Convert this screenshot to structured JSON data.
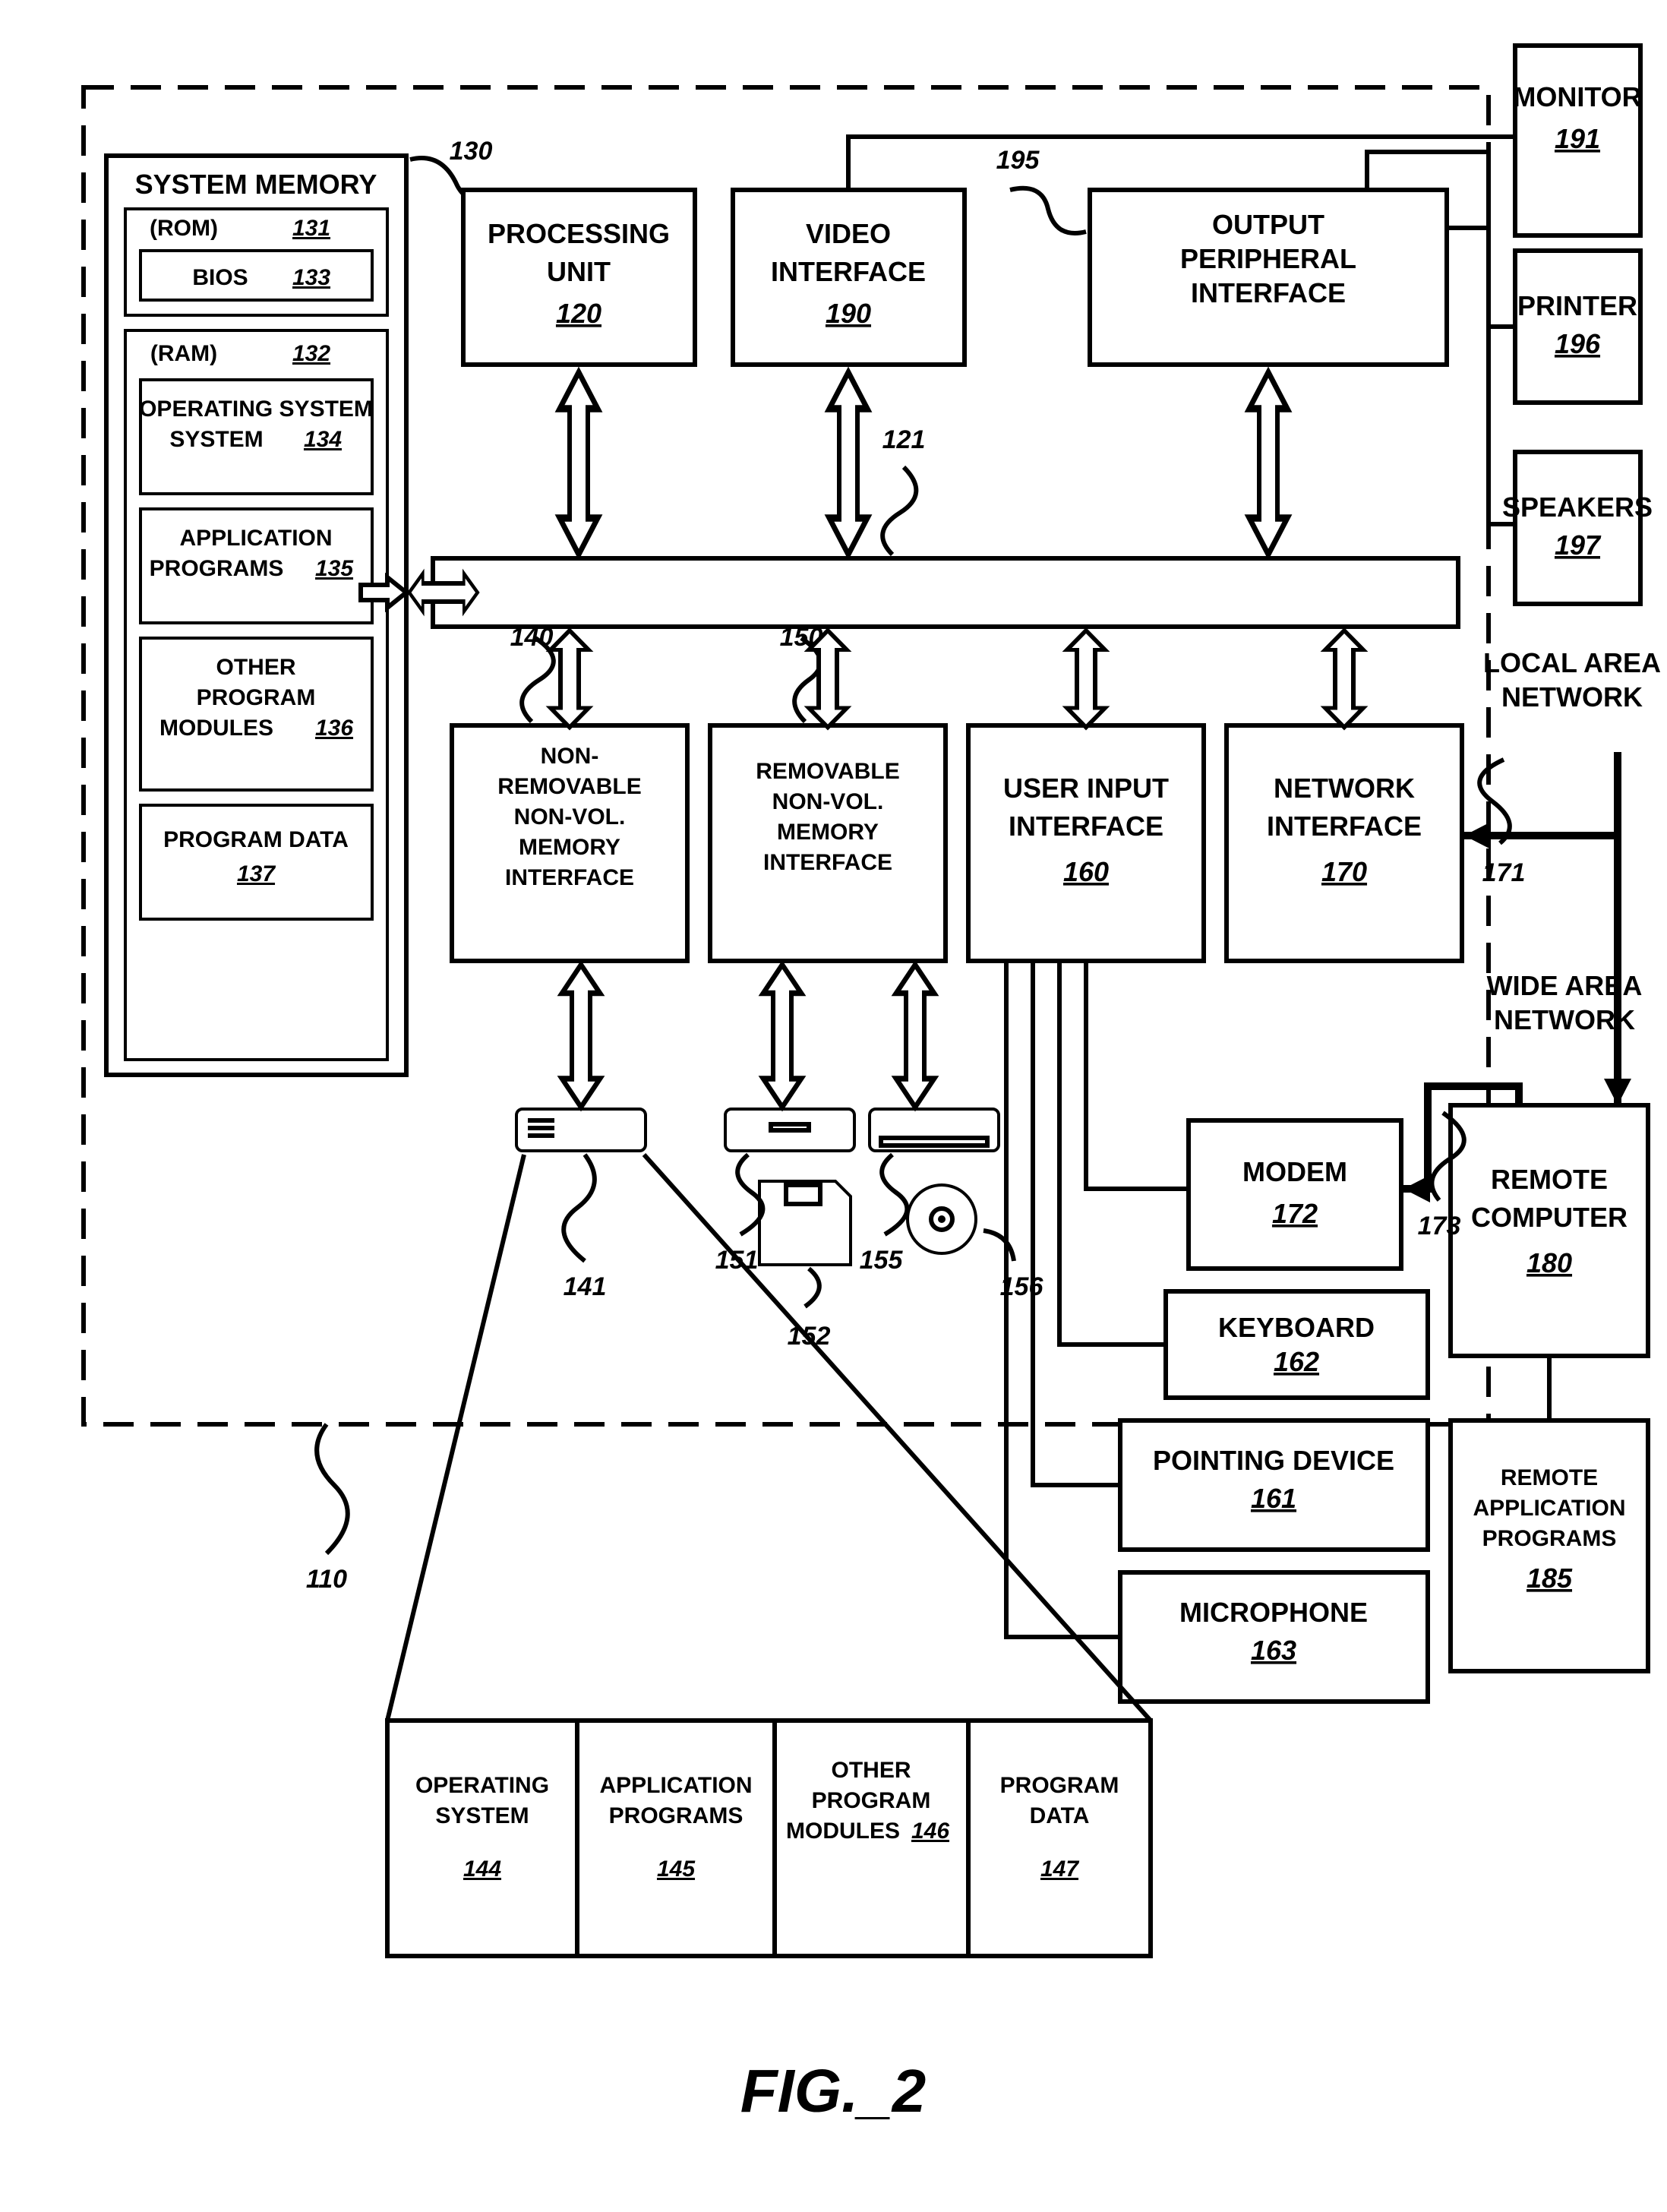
{
  "figure_label": "FIG._2",
  "computer_ref": "110",
  "system_memory": {
    "title": "SYSTEM MEMORY",
    "rom": "(ROM)",
    "rom_ref": "131",
    "bios": "BIOS",
    "bios_ref": "133",
    "ram": "(RAM)",
    "ram_ref": "132",
    "os": "OPERATING SYSTEM",
    "os_ref": "134",
    "apps": "APPLICATION PROGRAMS",
    "apps_ref": "135",
    "other": "OTHER PROGRAM MODULES",
    "other_ref": "136",
    "pdata": "PROGRAM DATA",
    "pdata_ref": "137",
    "sm_ref": "130"
  },
  "processing_unit": {
    "title": "PROCESSING UNIT",
    "ref": "120"
  },
  "video": {
    "title": "VIDEO INTERFACE",
    "ref": "190"
  },
  "output_periph": {
    "title": "OUTPUT PERIPHERAL INTERFACE",
    "ref": "195"
  },
  "monitor": {
    "title": "MONITOR",
    "ref": "191"
  },
  "printer": {
    "title": "PRINTER",
    "ref": "196"
  },
  "speakers": {
    "title": "SPEAKERS",
    "ref": "197"
  },
  "bus_ref": "121",
  "nonrem": {
    "l1": "NON-",
    "l2": "REMOVABLE",
    "l3": "NON-VOL.",
    "l4": "MEMORY",
    "l5": "INTERFACE",
    "ref": "140"
  },
  "rem": {
    "l1": "REMOVABLE",
    "l2": "NON-VOL.",
    "l3": "MEMORY",
    "l4": "INTERFACE",
    "ref": "150"
  },
  "userinput": {
    "title": "USER INPUT INTERFACE",
    "ref": "160"
  },
  "network": {
    "title": "NETWORK INTERFACE",
    "ref": "170"
  },
  "modem": {
    "title": "MODEM",
    "ref": "172"
  },
  "keyboard": {
    "title": "KEYBOARD",
    "ref": "162"
  },
  "pointing": {
    "title": "POINTING DEVICE",
    "ref": "161"
  },
  "microphone": {
    "title": "MICROPHONE",
    "ref": "163"
  },
  "remote": {
    "title": "REMOTE COMPUTER",
    "ref": "180"
  },
  "remote_apps": {
    "l1": "REMOTE",
    "l2": "APPLICATION",
    "l3": "PROGRAMS",
    "ref": "185"
  },
  "lan": {
    "title": "LOCAL AREA NETWORK",
    "ref": "171"
  },
  "wan": {
    "title": "WIDE AREA NETWORK",
    "ref": "173"
  },
  "hdd_ref": "141",
  "floppy_ref": "151",
  "floppy_media_ref": "152",
  "optical_ref": "155",
  "optical_media_ref": "156",
  "disk_contents": {
    "os": "OPERATING SYSTEM",
    "os_ref": "144",
    "apps": "APPLICATION PROGRAMS",
    "apps_ref": "145",
    "other": "OTHER PROGRAM MODULES",
    "other_ref": "146",
    "pdata": "PROGRAM DATA",
    "pdata_ref": "147"
  }
}
